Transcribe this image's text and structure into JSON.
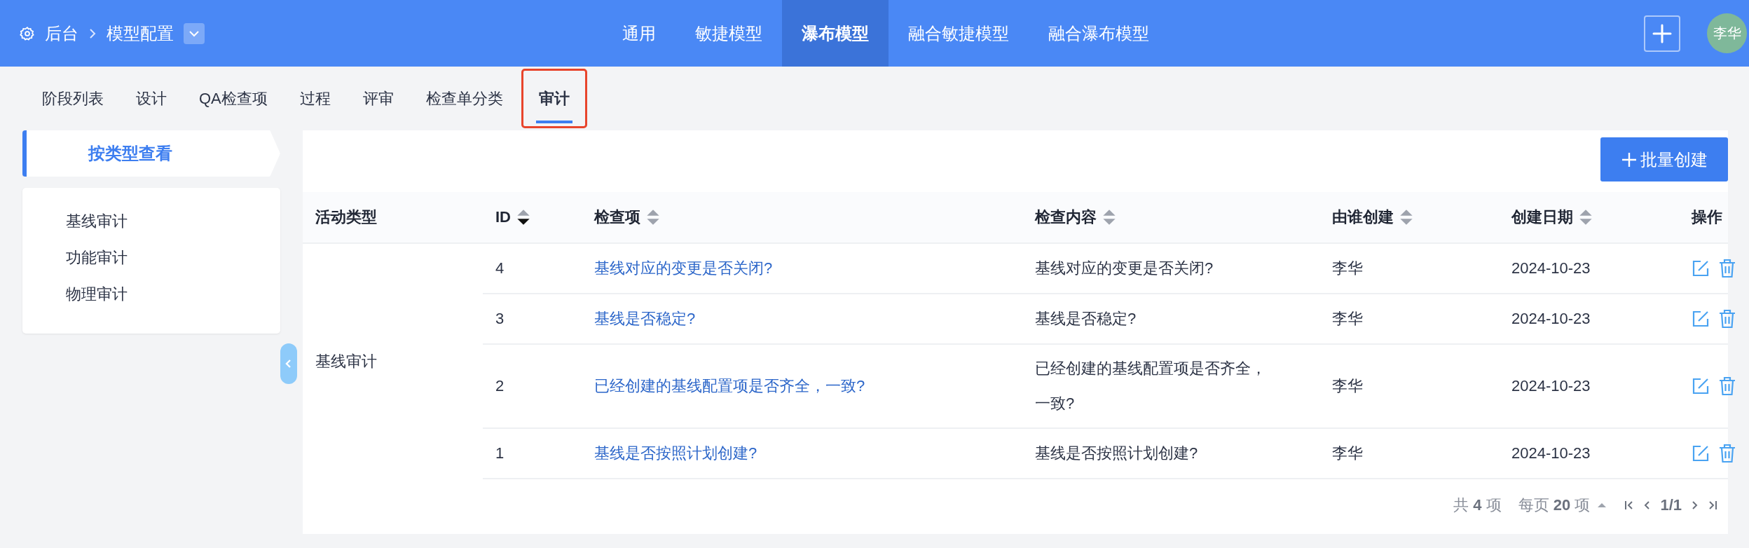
{
  "header": {
    "breadcrumb": {
      "home": "后台",
      "current": "模型配置"
    },
    "nav_tabs": [
      {
        "label": "通用",
        "selected": false
      },
      {
        "label": "敏捷模型",
        "selected": false
      },
      {
        "label": "瀑布模型",
        "selected": true
      },
      {
        "label": "融合敏捷模型",
        "selected": false
      },
      {
        "label": "融合瀑布模型",
        "selected": false
      }
    ],
    "avatar": "李华"
  },
  "sub_tabs": [
    {
      "label": "阶段列表",
      "selected": false,
      "highlighted": false
    },
    {
      "label": "设计",
      "selected": false,
      "highlighted": false
    },
    {
      "label": "QA检查项",
      "selected": false,
      "highlighted": false
    },
    {
      "label": "过程",
      "selected": false,
      "highlighted": false
    },
    {
      "label": "评审",
      "selected": false,
      "highlighted": false
    },
    {
      "label": "检查单分类",
      "selected": false,
      "highlighted": false
    },
    {
      "label": "审计",
      "selected": true,
      "highlighted": true
    }
  ],
  "sidebar": {
    "view_header": "按类型查看",
    "items": [
      "基线审计",
      "功能审计",
      "物理审计"
    ]
  },
  "toolbar": {
    "create_button": "批量创建"
  },
  "table": {
    "columns": [
      {
        "label": "活动类型",
        "sortable": false,
        "sorted_descending": false
      },
      {
        "label": "ID",
        "sortable": true,
        "sorted_descending": true
      },
      {
        "label": "检查项",
        "sortable": true,
        "sorted_descending": false
      },
      {
        "label": "检查内容",
        "sortable": true,
        "sorted_descending": false
      },
      {
        "label": "由谁创建",
        "sortable": true,
        "sorted_descending": false
      },
      {
        "label": "创建日期",
        "sortable": true,
        "sorted_descending": false
      },
      {
        "label": "操作",
        "sortable": false,
        "sorted_descending": false
      }
    ],
    "group": "基线审计",
    "rows": [
      {
        "id": "4",
        "item": "基线对应的变更是否关闭?",
        "content": "基线对应的变更是否关闭?",
        "creator": "李华",
        "date": "2024-10-23"
      },
      {
        "id": "3",
        "item": "基线是否稳定?",
        "content": "基线是否稳定?",
        "creator": "李华",
        "date": "2024-10-23"
      },
      {
        "id": "2",
        "item": "已经创建的基线配置项是否齐全，一致?",
        "content": "已经创建的基线配置项是否齐全，一致?",
        "creator": "李华",
        "date": "2024-10-23"
      },
      {
        "id": "1",
        "item": "基线是否按照计划创建?",
        "content": "基线是否按照计划创建?",
        "creator": "李华",
        "date": "2024-10-23"
      }
    ]
  },
  "pagination": {
    "total": "共 **4** 项",
    "page_size": "每页 **20** 项",
    "page": "1/1"
  }
}
